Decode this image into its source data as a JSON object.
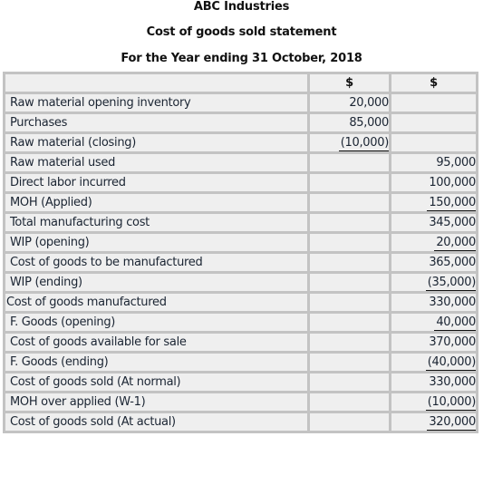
{
  "header": {
    "company": "ABC Industries",
    "statement": "Cost of goods sold statement",
    "period": "For the Year ending 31 October, 2018"
  },
  "table": {
    "columns": [
      "",
      "$",
      "$"
    ],
    "rows": [
      {
        "label": "Raw material opening inventory",
        "col1": "20,000",
        "col2": "",
        "underline": ""
      },
      {
        "label": "Purchases",
        "col1": "85,000",
        "col2": "",
        "underline": ""
      },
      {
        "label": "Raw material (closing)",
        "col1": "(10,000)",
        "col2": "",
        "underline": "col1"
      },
      {
        "label": "Raw material used",
        "col1": "",
        "col2": "95,000",
        "underline": ""
      },
      {
        "label": "Direct labor incurred",
        "col1": "",
        "col2": "100,000",
        "underline": ""
      },
      {
        "label": "MOH (Applied)",
        "col1": "",
        "col2": "150,000",
        "underline": "col2"
      },
      {
        "label": "Total manufacturing cost",
        "col1": "",
        "col2": "345,000",
        "underline": ""
      },
      {
        "label": "WIP (opening)",
        "col1": "",
        "col2": "20,000",
        "underline": "col2"
      },
      {
        "label": "Cost of goods to be manufactured",
        "col1": "",
        "col2": "365,000",
        "underline": ""
      },
      {
        "label": "WIP (ending)",
        "col1": "",
        "col2": "(35,000)",
        "underline": "col2"
      },
      {
        "label": "Cost of goods manufactured",
        "col1": "",
        "col2": "330,000",
        "underline": ""
      },
      {
        "label": "F. Goods (opening)",
        "col1": "",
        "col2": "40,000",
        "underline": "col2"
      },
      {
        "label": "Cost of goods available for sale",
        "col1": "",
        "col2": "370,000",
        "underline": ""
      },
      {
        "label": "F. Goods (ending)",
        "col1": "",
        "col2": "(40,000)",
        "underline": "col2"
      },
      {
        "label": "Cost of goods sold (At normal)",
        "col1": "",
        "col2": "330,000",
        "underline": ""
      },
      {
        "label": "MOH over applied (W-1)",
        "col1": "",
        "col2": "(10,000)",
        "underline": "col2"
      },
      {
        "label": "Cost of goods sold (At actual)",
        "col1": "",
        "col2": "320,000",
        "underline": "col2"
      }
    ]
  }
}
